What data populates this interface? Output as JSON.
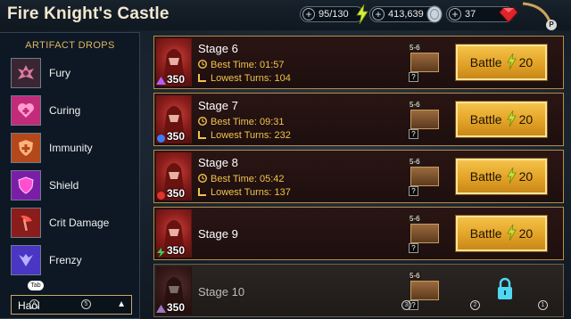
{
  "header": {
    "title": "Fire Knight's Castle",
    "energy": "95/130",
    "silver": "413,639",
    "gems": "37",
    "plus": "+",
    "p_badge": "P"
  },
  "artifact_drops": {
    "title": "ARTIFACT DROPS",
    "items": [
      {
        "label": "Fury",
        "icon": "fury-icon"
      },
      {
        "label": "Curing",
        "icon": "heart-icon"
      },
      {
        "label": "Immunity",
        "icon": "immunity-shield-icon"
      },
      {
        "label": "Shield",
        "icon": "shield-icon"
      },
      {
        "label": "Crit Damage",
        "icon": "axe-icon"
      },
      {
        "label": "Frenzy",
        "icon": "frenzy-icon"
      }
    ],
    "tab_badge": "Tab",
    "set_select_value": "Haol",
    "badge_a": "A",
    "badge_5": "5"
  },
  "stages": [
    {
      "name": "Stage 6",
      "level": "350",
      "best_time_label": "Best Time:",
      "best_time": "01:57",
      "lowest_turns_label": "Lowest Turns:",
      "lowest_turns": "104",
      "rank": "5-6",
      "battle_label": "Battle",
      "battle_cost": "20",
      "locked": false
    },
    {
      "name": "Stage 7",
      "level": "350",
      "best_time_label": "Best Time:",
      "best_time": "09:31",
      "lowest_turns_label": "Lowest Turns:",
      "lowest_turns": "232",
      "rank": "5-6",
      "battle_label": "Battle",
      "battle_cost": "20",
      "locked": false
    },
    {
      "name": "Stage 8",
      "level": "350",
      "best_time_label": "Best Time:",
      "best_time": "05:42",
      "lowest_turns_label": "Lowest Turns:",
      "lowest_turns": "137",
      "rank": "5-6",
      "battle_label": "Battle",
      "battle_cost": "20",
      "locked": false
    },
    {
      "name": "Stage 9",
      "level": "350",
      "rank": "5-6",
      "battle_label": "Battle",
      "battle_cost": "20",
      "locked": false
    },
    {
      "name": "Stage 10",
      "level": "350",
      "rank": "5-6",
      "locked": true
    }
  ],
  "chest_unknown": "?",
  "bottom_badges": {
    "b3": "3",
    "b2": "2",
    "b1": "1"
  },
  "colors": {
    "accent_gold": "#f1c24e",
    "button_gold": "#e0a024",
    "frame_gold": "#b88d42"
  }
}
